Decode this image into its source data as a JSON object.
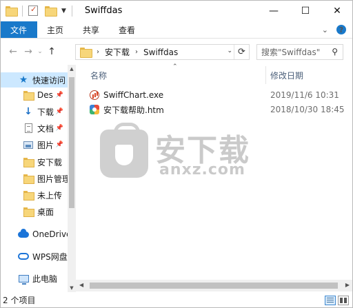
{
  "window": {
    "title": "Swiffdas",
    "minimize_glyph": "—",
    "maximize_glyph": "☐",
    "close_glyph": "✕"
  },
  "ribbon": {
    "tabs": [
      {
        "label": "文件",
        "active": true
      },
      {
        "label": "主页"
      },
      {
        "label": "共享"
      },
      {
        "label": "查看"
      }
    ],
    "expand_glyph": "⌄",
    "help_glyph": "?"
  },
  "nav": {
    "back_glyph": "←",
    "forward_glyph": "→",
    "recent_glyph": "⌄",
    "up_glyph": "↑"
  },
  "address": {
    "breadcrumbs": [
      "安下载",
      "Swiffdas"
    ],
    "separator": "›",
    "dropdown_glyph": "⌄",
    "refresh_glyph": "⟳"
  },
  "search": {
    "placeholder": "搜索\"Swiffdas\"",
    "icon": "search-icon"
  },
  "sidebar": {
    "items": [
      {
        "label": "快速访问",
        "icon": "star-icon",
        "selected": true
      },
      {
        "label": "Des",
        "icon": "folder-icon",
        "pinned": true
      },
      {
        "label": "下载",
        "icon": "download-icon",
        "pinned": true
      },
      {
        "label": "文档",
        "icon": "document-icon",
        "pinned": true
      },
      {
        "label": "图片",
        "icon": "pictures-icon",
        "pinned": true
      },
      {
        "label": "安下载",
        "icon": "folder-icon"
      },
      {
        "label": "图片管理",
        "icon": "folder-icon"
      },
      {
        "label": "未上传",
        "icon": "folder-icon"
      },
      {
        "label": "桌面",
        "icon": "folder-icon"
      },
      {
        "label": "OneDrive",
        "icon": "onedrive-icon"
      },
      {
        "label": "WPS网盘",
        "icon": "wps-cloud-icon"
      },
      {
        "label": "此电脑",
        "icon": "this-pc-icon"
      }
    ],
    "pin_glyph": "📌"
  },
  "file_list": {
    "columns": {
      "name": "名称",
      "date": "修改日期"
    },
    "sort_glyph": "⌃",
    "files": [
      {
        "name": "SwiffChart.exe",
        "date": "2019/11/6 10:31",
        "icon": "exe-icon"
      },
      {
        "name": "安下载帮助.htm",
        "date": "2018/10/30 18:45",
        "icon": "htm-icon"
      }
    ]
  },
  "watermark": {
    "text_cn": "安下载",
    "text_en": "anxz.com"
  },
  "status": {
    "item_count": "2 个项目"
  },
  "scroll_glyphs": {
    "up": "▲",
    "down": "▼",
    "left": "◀",
    "right": "▶"
  }
}
